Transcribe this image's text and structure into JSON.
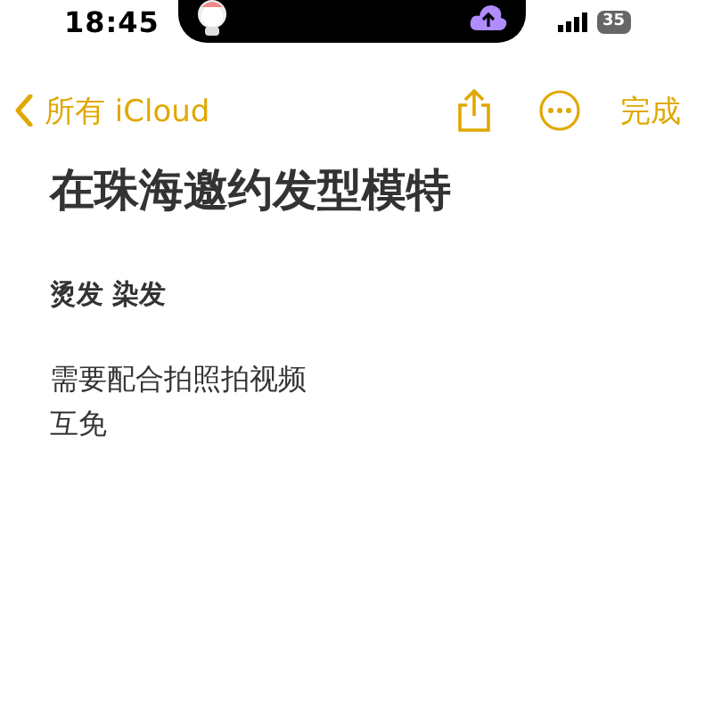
{
  "status_bar": {
    "time": "18:45",
    "battery": "35"
  },
  "nav": {
    "back": "所有 iCloud",
    "done": "完成"
  },
  "note": {
    "title": "在珠海邀约发型模特",
    "blocks": [
      {
        "kind": "bold",
        "lines": [
          "烫发 染发"
        ]
      },
      {
        "kind": "plain",
        "lines": [
          "需要配合拍照拍视频",
          "互免"
        ]
      }
    ]
  }
}
